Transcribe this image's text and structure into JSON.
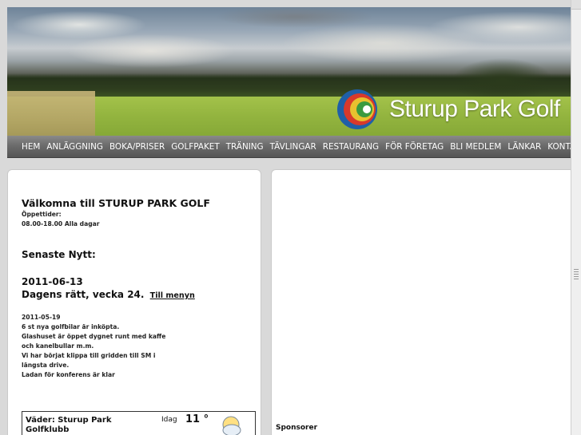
{
  "header": {
    "logo_text": "Sturup Park Golf",
    "logo_icon": "golf-ball-logo-icon"
  },
  "nav": {
    "items": [
      "HEM",
      "ANLÄGGNING",
      "BOKA/PRISER",
      "GOLFPAKET",
      "TRÄNING",
      "TÄVLINGAR",
      "RESTAURANG",
      "FÖR FÖRETAG",
      "BLI MEDLEM",
      "LÄNKAR",
      "KONTAKT"
    ]
  },
  "welcome": {
    "title": "Välkomna till STURUP PARK GOLF",
    "hours_label": "Öppettider:",
    "hours_value": "08.00-18.00 Alla dagar"
  },
  "news": {
    "title": "Senaste Nytt:",
    "date": "2011-06-13",
    "headline": "Dagens rätt, vecka 24.",
    "menu_link": "Till menyn",
    "body_lines": [
      "2011-05-19",
      "6 st nya golfbilar är inköpta.",
      "Glashuset är öppet dygnet runt med kaffe",
      "och kanelbullar m.m.",
      "Vi har börjat klippa till gridden till SM i",
      "längsta drive.",
      "Ladan för konferens är klar"
    ]
  },
  "weather": {
    "title": "Väder: Sturup Park Golfklubb",
    "day": "Idag",
    "temperature": "11 °",
    "icon": "partly-cloudy-icon"
  },
  "sidebar": {
    "sponsor_label": "Sponsorer"
  },
  "colors": {
    "nav_bg": "#6c6c6c",
    "page_bg": "#d9d9d9",
    "logo_blue": "#1f5fa8",
    "logo_red": "#d8392b",
    "logo_yellow": "#e8c12f",
    "logo_green": "#3a9a3f"
  }
}
